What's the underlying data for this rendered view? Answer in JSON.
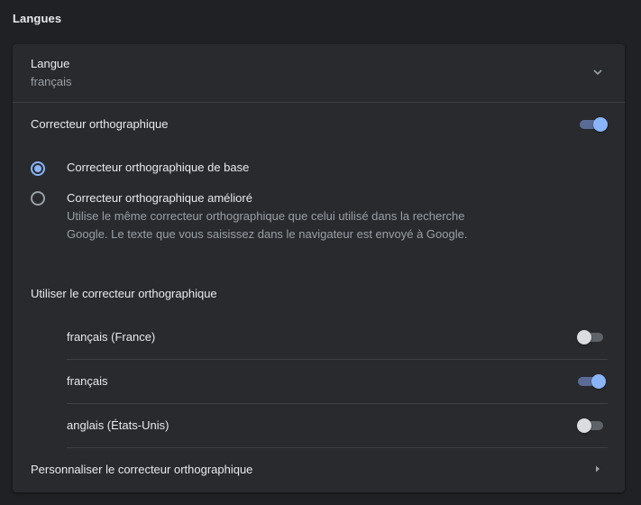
{
  "section": {
    "title": "Langues"
  },
  "language": {
    "label": "Langue",
    "value": "français"
  },
  "spellcheck": {
    "title": "Correcteur orthographique",
    "enabled": true,
    "options": [
      {
        "label": "Correcteur orthographique de base",
        "checked": true
      },
      {
        "label": "Correcteur orthographique amélioré",
        "checked": false,
        "description": "Utilise le même correcteur orthographique que celui utilisé dans la recherche Google. Le texte que vous saisissez dans le navigateur est envoyé à Google."
      }
    ],
    "use_title": "Utiliser le correcteur orthographique",
    "languages": [
      {
        "label": "français (France)",
        "enabled": false
      },
      {
        "label": "français",
        "enabled": true
      },
      {
        "label": "anglais (États-Unis)",
        "enabled": false
      }
    ],
    "customize_label": "Personnaliser le correcteur orthographique"
  },
  "icons": {
    "expand": "chevron-down-icon",
    "navigate": "chevron-right-icon"
  },
  "colors": {
    "background": "#202124",
    "card": "#292a2d",
    "accent": "#8ab4f8",
    "text_primary": "#e8eaed",
    "text_secondary": "#9aa0a6"
  }
}
